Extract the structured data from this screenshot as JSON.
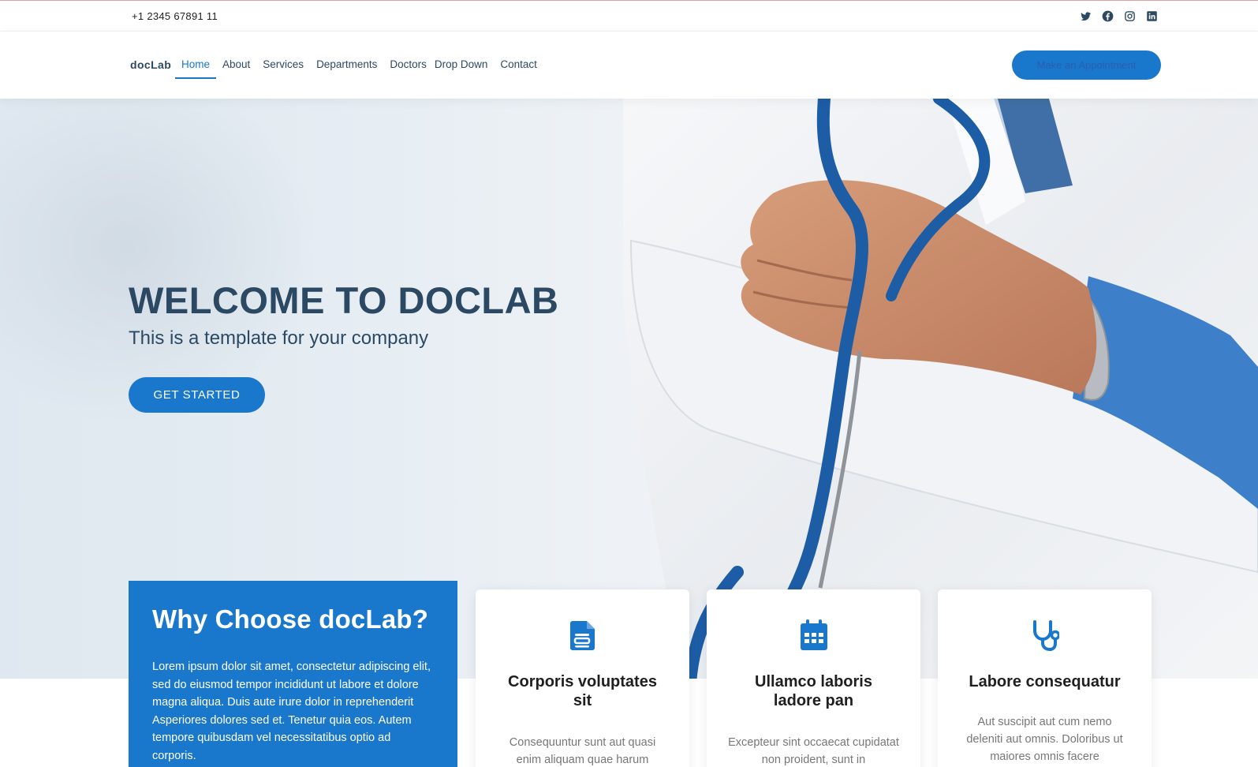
{
  "topbar": {
    "phone": "+1 2345 67891 11",
    "socials": [
      "twitter-icon",
      "facebook-icon",
      "instagram-icon",
      "linkedin-icon"
    ]
  },
  "header": {
    "logo": "docLab",
    "nav": [
      "Home",
      "About",
      "Services",
      "Departments",
      "Doctors",
      "Drop Down",
      "Contact"
    ],
    "active_nav": "Home",
    "appointment_label": "Make an Appointment"
  },
  "hero": {
    "title": "WELCOME TO DOCLAB",
    "subtitle": "This is a template for your company",
    "cta_label": "GET STARTED"
  },
  "why": {
    "title": "Why Choose docLab?",
    "text": "Lorem ipsum dolor sit amet, consectetur adipiscing elit, sed do eiusmod tempor incididunt ut labore et dolore magna aliqua. Duis aute irure dolor in reprehenderit Asperiores dolores sed et. Tenetur quia eos. Autem tempore quibusdam vel necessitatibus optio ad corporis."
  },
  "cards": [
    {
      "icon": "document-icon",
      "title": "Corporis voluptates sit",
      "text": "Consequuntur sunt aut quasi enim aliquam quae harum"
    },
    {
      "icon": "calendar-icon",
      "title": "Ullamco laboris ladore pan",
      "text": "Excepteur sint occaecat cupidatat non proident, sunt in"
    },
    {
      "icon": "stethoscope-icon",
      "title": "Labore consequatur",
      "text": "Aut suscipit aut cum nemo deleniti aut omnis. Doloribus ut maiores omnis facere"
    }
  ],
  "colors": {
    "accent": "#1977cc",
    "heading": "#2c4964",
    "body_text": "#777777"
  }
}
